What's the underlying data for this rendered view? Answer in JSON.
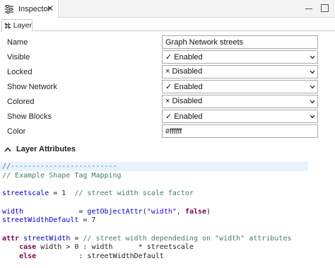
{
  "view": {
    "title": "Inspector",
    "close_symbol": "✕"
  },
  "subtab": {
    "label": "Layer"
  },
  "properties": [
    {
      "label": "Name",
      "kind": "input",
      "value": "Graph Network streets"
    },
    {
      "label": "Visible",
      "kind": "select",
      "value": "✓ Enabled"
    },
    {
      "label": "Locked",
      "kind": "select",
      "value": "× Disabled"
    },
    {
      "label": "Show Network",
      "kind": "select",
      "value": "✓ Enabled"
    },
    {
      "label": "Colored",
      "kind": "select",
      "value": "× Disabled"
    },
    {
      "label": "Show Blocks",
      "kind": "select",
      "value": "✓ Enabled"
    },
    {
      "label": "Color",
      "kind": "input",
      "value": "#ffffff"
    }
  ],
  "section": {
    "title": "Layer Attributes"
  },
  "code": {
    "lines": [
      [
        {
          "t": "//-------------------------",
          "c": "comment"
        }
      ],
      [
        {
          "t": "// Example Shape Tag Mapping",
          "c": "comment"
        }
      ],
      [],
      [
        {
          "t": "streetscale",
          "c": "var"
        },
        {
          "t": " = 1  ",
          "c": "plain"
        },
        {
          "t": "// street width scale factor",
          "c": "comment"
        }
      ],
      [],
      [
        {
          "t": "width",
          "c": "var"
        },
        {
          "t": "             = ",
          "c": "plain"
        },
        {
          "t": "getObjectAttr",
          "c": "func"
        },
        {
          "t": "(",
          "c": "plain"
        },
        {
          "t": "\"width\"",
          "c": "str"
        },
        {
          "t": ", ",
          "c": "plain"
        },
        {
          "t": "false",
          "c": "kw"
        },
        {
          "t": ")",
          "c": "plain"
        }
      ],
      [
        {
          "t": "streetWidthDefault",
          "c": "var"
        },
        {
          "t": " = 7",
          "c": "plain"
        }
      ],
      [],
      [
        {
          "t": "attr ",
          "c": "kw"
        },
        {
          "t": "streetWidth",
          "c": "var"
        },
        {
          "t": " = ",
          "c": "plain"
        },
        {
          "t": "// street width dependeding on \"width\" attributes",
          "c": "comment"
        }
      ],
      [
        {
          "t": "    ",
          "c": "plain"
        },
        {
          "t": "case",
          "c": "kw"
        },
        {
          "t": " width > 0 : width      * streetscale",
          "c": "plain"
        }
      ],
      [
        {
          "t": "    ",
          "c": "plain"
        },
        {
          "t": "else",
          "c": "kw"
        },
        {
          "t": "          : streetWidthDefault",
          "c": "plain"
        }
      ]
    ]
  }
}
